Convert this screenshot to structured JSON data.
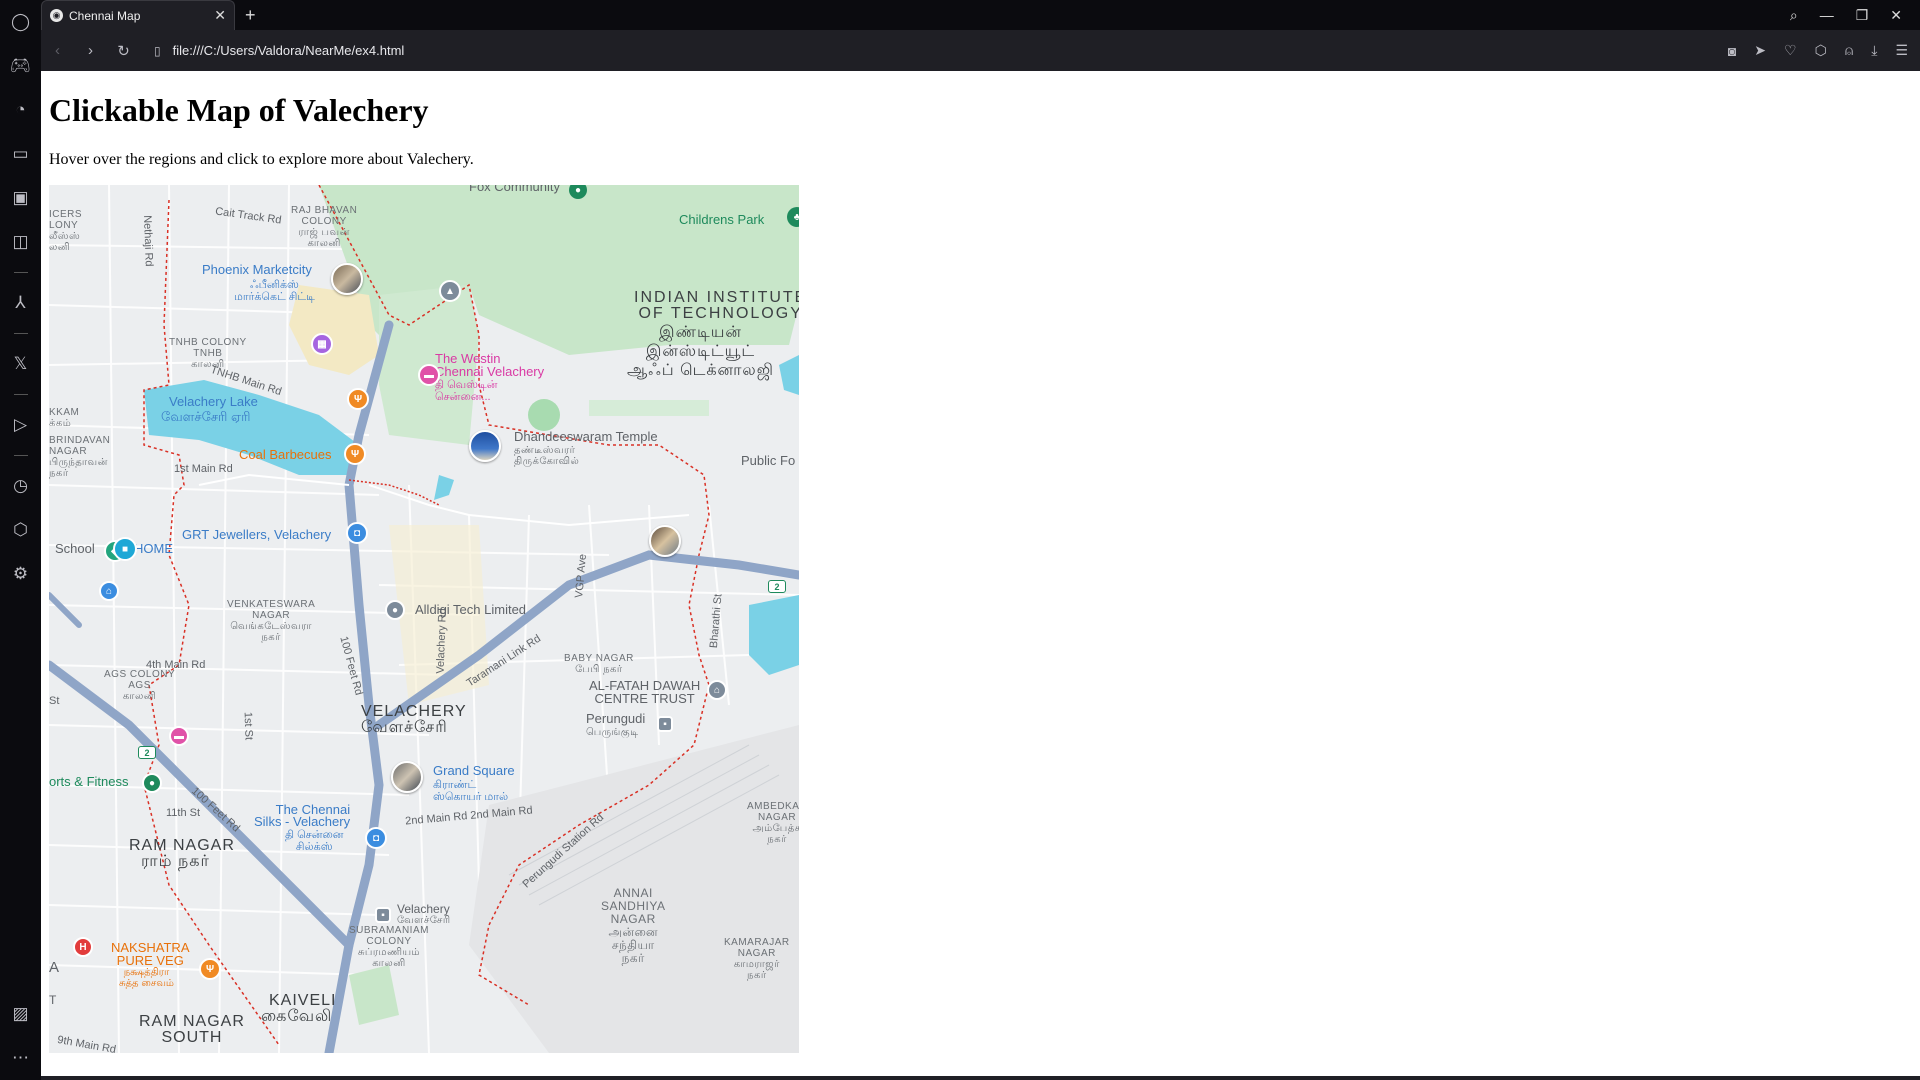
{
  "browser": {
    "tab_title": "Chennai Map",
    "new_tab": "+",
    "url": "file:///C:/Users/Valdora/NearMe/ex4.html"
  },
  "page": {
    "title": "Clickable Map of Valechery",
    "subtitle": "Hover over the regions and click to explore more about Valechery."
  },
  "map": {
    "labels": {
      "fox_community": "Fox Community",
      "childrens_park": "Childrens Park",
      "raj_bhavan": "RAJ BHAVAN\nCOLONY\nராஜ் பவன்\nகாலனி",
      "phoenix": "Phoenix Marketcity",
      "phoenix_ta": "ஃபீனிக்ஸ்\nமார்க்கெட் சிட்டி",
      "iit": "INDIAN INSTITUTE\nOF TECHNOLOGY",
      "iit_ta": "இண்டியன்\nஇன்ஸ்டிட்யூட்\nஆஃப் டெக்னாலஜி",
      "tnhb_colony": "TNHB COLONY\nTNHB\nகாலனி",
      "tnhb_main": "TNHB Main Rd",
      "westin": "The Westin\nChennai Velachery",
      "westin_ta": "தி வெஸ்டின்\nசென்னை...",
      "velachery_lake": "Velachery Lake",
      "velachery_lake_ta": "வேளச்சேரி ஏரி",
      "dhandeeswaram": "Dhandeeswaram Temple",
      "dhandeeswaram_ta": "தண்டீஸ்வரர்\nதிருக்கோவில்",
      "public_fo": "Public Fo",
      "coal_barbecues": "Coal Barbecues",
      "first_main": "1st Main Rd",
      "brindavan": "BRINDAVAN\nNAGAR\nபிருந்தாவன்\nநகர்",
      "grt": "GRT Jewellers, Velachery",
      "school": "School",
      "home": "HOME",
      "venkateswara": "VENKATESWARA\nNAGAR\nவெங்கடேஸ்வரா\nநகர்",
      "alldigi": "Alldigi Tech Limited",
      "vgp_ave": "VGP Ave",
      "baby_nagar": "BABY NAGAR\nபேபி நகர்",
      "alfatah": "AL-FATAH DAWAH\nCENTRE TRUST",
      "taramani": "Taramani Link Rd",
      "ags_colony": "AGS COLONY\nAGS\nகாலனி",
      "fourth_main": "4th Main Rd",
      "velachery": "VELACHERY",
      "velachery_ta": "வேளச்சேரி",
      "perungudi": "Perungudi",
      "perungudi_ta": "பெருங்குடி",
      "grand_square": "Grand Square",
      "grand_square_ta": "கிராண்ட்\nஸ்கொயர் மால்",
      "sports_fitness": "orts & Fitness",
      "eleventh": "11th St",
      "hundred_feet": "100 Feet Rd",
      "chennai_silks": "The Chennai\nSilks - Velachery",
      "chennai_silks_ta": "தி சென்னை\nசில்க்ஸ்",
      "second_main": "2nd Main Rd  2nd Main Rd",
      "ram_nagar": "RAM NAGAR",
      "ram_nagar_ta": "ராம் நகர்",
      "ambedkar": "AMBEDKAR\nNAGAR\nஅம்பேத்க\nநகர்",
      "perungudi_station": "Perungudi Station Rd",
      "annai": "ANNAI\nSANDHIYA\nNAGAR\nஅன்னை\nசந்தியா\nநகர்",
      "velachery_stn": "Velachery",
      "velachery_stn_ta": "வேளச்சேரி",
      "nakshatra": "NAKSHATRA\nPURE VEG",
      "nakshatra_ta": "நக்ஷத்திரா\nசுத்த சைவம்",
      "subramaniam": "SUBRAMANIAM\nCOLONY\nசுப்ரமணியம்\nகாலனி",
      "kamarajar": "KAMARAJAR\nNAGAR\nகாமராஜர்\nநகர்",
      "kaiveli": "KAIVELI",
      "kaiveli_ta": "கைவேலி",
      "ram_nagar_south": "RAM NAGAR\nSOUTH",
      "ninth_main": "9th Main Rd",
      "bharathi": "Bharathi St",
      "velachery_rd": "Velachery Rd",
      "first_st": "1st St",
      "cait_track": "Cait Track Rd",
      "nethaji": "Nethaji Rd",
      "icers": "ICERS\nLONY\nலீஸ்ஸ்\nலனி",
      "kkam": "KKAM\nக்கம்",
      "a_edge": "A",
      "t_edge": "T",
      "st_edge": "St",
      "road_2": "2"
    }
  }
}
